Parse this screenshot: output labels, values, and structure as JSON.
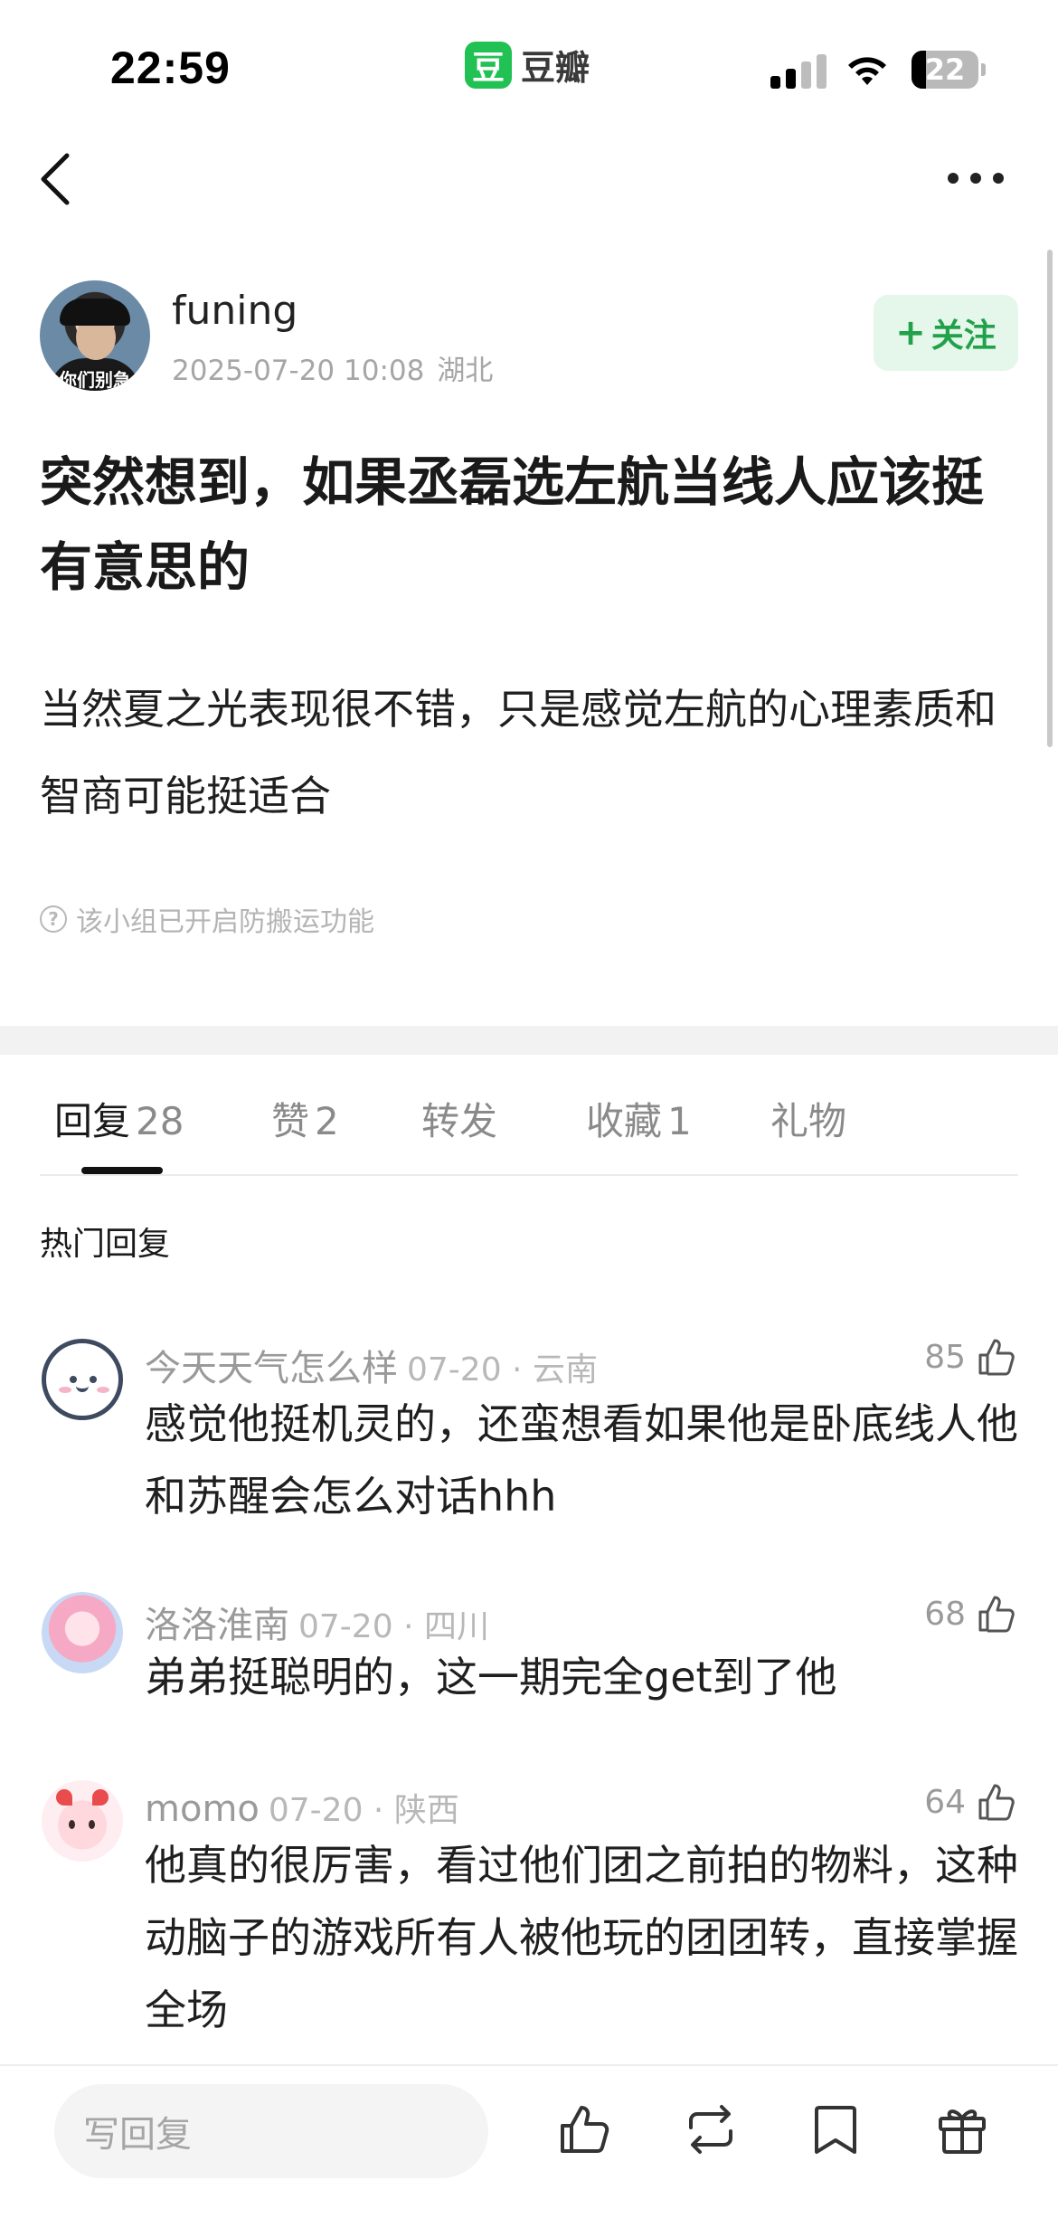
{
  "status_bar": {
    "time": "22:59",
    "app_logo_char": "豆",
    "app_name": "豆瓣",
    "battery": "22",
    "battery_level": 0.22
  },
  "nav": {
    "back_icon": "chevron-left-icon",
    "more_icon": "more-horizontal-icon"
  },
  "post": {
    "author": "funing",
    "avatar_watermark": "你们别急",
    "datetime": "2025-07-20 10:08",
    "location": "湖北",
    "follow_label": "关注",
    "title": "突然想到，如果丞磊选左航当线人应该挺有意思的",
    "body": "当然夏之光表现很不错，只是感觉左航的心理素质和智商可能挺适合",
    "notice": "该小组已开启防搬运功能"
  },
  "tabs": [
    {
      "label": "回复",
      "count": "28"
    },
    {
      "label": "赞",
      "count": "2"
    },
    {
      "label": "转发",
      "count": ""
    },
    {
      "label": "收藏",
      "count": "1"
    },
    {
      "label": "礼物",
      "count": ""
    }
  ],
  "hot_replies_label": "热门回复",
  "comments": [
    {
      "name": "今天天气怎么样",
      "meta": "07-20 · 云南",
      "likes": "85",
      "text": "感觉他挺机灵的，还蛮想看如果他是卧底线人他和苏醒会怎么对话hhh"
    },
    {
      "name": "洛洛淮南",
      "meta": "07-20 · 四川",
      "likes": "68",
      "text": "弟弟挺聪明的，这一期完全get到了他"
    },
    {
      "name": "momo",
      "meta": "07-20 · 陕西",
      "likes": "64",
      "text": "他真的很厉害，看过他们团之前拍的物料，这种动脑子的游戏所有人被他玩的团团转，直接掌握全场"
    }
  ],
  "bottom_bar": {
    "reply_placeholder": "写回复",
    "icons": [
      "thumbs-up-icon",
      "repost-icon",
      "bookmark-icon",
      "gift-icon"
    ]
  },
  "colors": {
    "accent_green": "#21a14a",
    "follow_bg": "#e5f6ea",
    "logo_green": "#22c154"
  }
}
